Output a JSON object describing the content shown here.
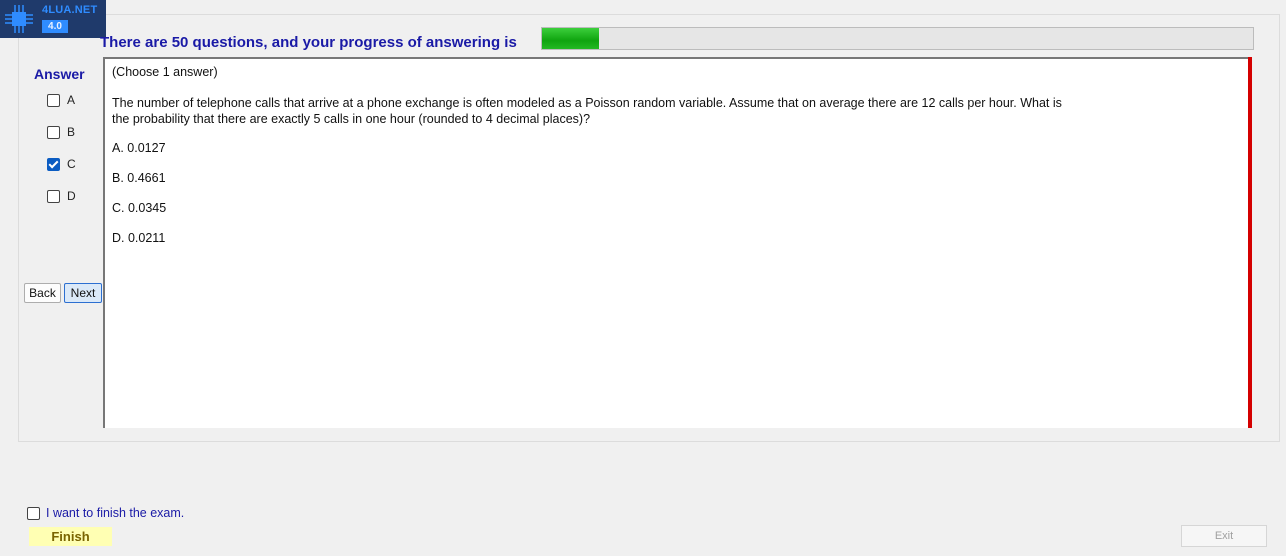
{
  "logo": {
    "site": "4LUA.NET",
    "sub": "4.0"
  },
  "header": {
    "progress_text": "There are 50 questions, and your progress of answering is",
    "progress_fraction": 0.08
  },
  "answer": {
    "heading": "Answer",
    "options": [
      {
        "label": "A",
        "checked": false
      },
      {
        "label": "B",
        "checked": false
      },
      {
        "label": "C",
        "checked": true
      },
      {
        "label": "D",
        "checked": false
      }
    ]
  },
  "nav": {
    "back_label": "Back",
    "next_label": "Next"
  },
  "question": {
    "instruction": "(Choose 1 answer)",
    "text": "The number of telephone calls that arrive at a phone exchange is often modeled as a Poisson random variable. Assume that on average there are 12 calls per hour. What is the probability that there are exactly 5 calls in one hour (rounded to 4 decimal places)?",
    "choices": [
      "A.  0.0127",
      "B.  0.4661",
      "C.  0.0345",
      "D.  0.0211"
    ]
  },
  "footer": {
    "finish_checkbox_label": "I want to finish the exam.",
    "finish_checked": false,
    "finish_label": "Finish",
    "exit_label": "Exit"
  },
  "colors": {
    "accent_text": "#1a1aa6",
    "progress": "#0fa40f",
    "scroll_marker": "#d40000"
  }
}
